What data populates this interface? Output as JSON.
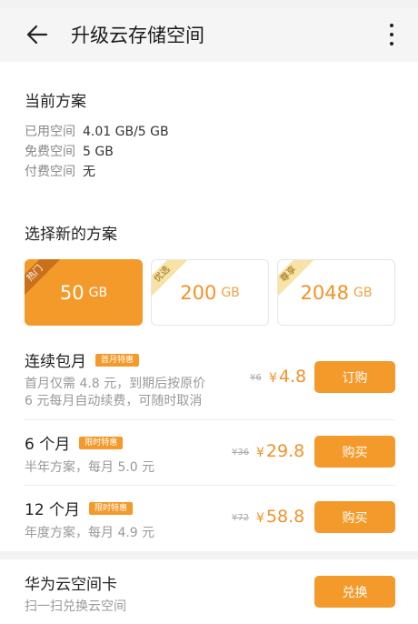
{
  "appbar": {
    "title": "升级云存储空间"
  },
  "current": {
    "heading": "当前方案",
    "used_label": "已用空间",
    "used_value": "4.01 GB/5 GB",
    "free_label": "免费空间",
    "free_value": "5 GB",
    "paid_label": "付费空间",
    "paid_value": "无"
  },
  "choose": {
    "heading": "选择新的方案",
    "plans": [
      {
        "badge": "热门",
        "size": "50",
        "unit": "GB",
        "selected": true
      },
      {
        "badge": "优选",
        "size": "200",
        "unit": "GB",
        "selected": false
      },
      {
        "badge": "尊享",
        "size": "2048",
        "unit": "GB",
        "selected": false
      }
    ]
  },
  "offers": [
    {
      "title": "连续包月",
      "tag": "首月特惠",
      "desc1": "首月仅需 4.8 元，到期后按原价",
      "desc2": "6 元每月自动续费，可随时取消",
      "old_price": "¥6",
      "currency": "¥",
      "price": "4.8",
      "button": "订购"
    },
    {
      "title": "6 个月",
      "tag": "限时特惠",
      "desc1": "半年方案，每月 5.0 元",
      "old_price": "¥36",
      "currency": "¥",
      "price": "29.8",
      "button": "购买"
    },
    {
      "title": "12 个月",
      "tag": "限时特惠",
      "desc1": "年度方案，每月 4.9 元",
      "old_price": "¥72",
      "currency": "¥",
      "price": "58.8",
      "button": "购买"
    }
  ],
  "card": {
    "title": "华为云空间卡",
    "desc": "扫一扫兑换云空间",
    "button": "兑换"
  },
  "colors": {
    "accent": "#f39a2b",
    "price": "#f0932a"
  }
}
